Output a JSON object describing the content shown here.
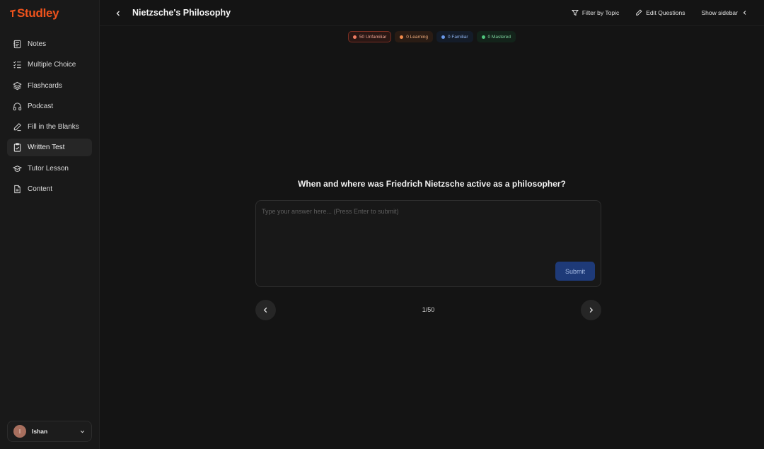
{
  "brand": {
    "name": "Studley",
    "color": "#f0531c"
  },
  "sidebar": {
    "items": [
      {
        "label": "Notes",
        "icon": "notes-icon",
        "active": false
      },
      {
        "label": "Multiple Choice",
        "icon": "list-check-icon",
        "active": false
      },
      {
        "label": "Flashcards",
        "icon": "layers-icon",
        "active": false
      },
      {
        "label": "Podcast",
        "icon": "headphones-icon",
        "active": false
      },
      {
        "label": "Fill in the Blanks",
        "icon": "pencil-icon",
        "active": false
      },
      {
        "label": "Written Test",
        "icon": "clipboard-check-icon",
        "active": true
      },
      {
        "label": "Tutor Lesson",
        "icon": "graduation-cap-icon",
        "active": false
      },
      {
        "label": "Content",
        "icon": "document-icon",
        "active": false
      }
    ],
    "user": {
      "initial": "I",
      "name": "Ishan"
    }
  },
  "header": {
    "title": "Nietzsche's Philosophy",
    "actions": {
      "filter": "Filter by Topic",
      "edit": "Edit Questions",
      "sidebar": "Show sidebar"
    }
  },
  "badges": {
    "unfamiliar": "50 Unfamiliar",
    "learning": "0 Learning",
    "familiar": "0 Familiar",
    "mastered": "0 Mastered"
  },
  "quiz": {
    "question": "When and where was Friedrich Nietzsche active as a philosopher?",
    "placeholder": "Type your answer here... (Press Enter to submit)",
    "submit_label": "Submit",
    "counter": "1/50"
  }
}
